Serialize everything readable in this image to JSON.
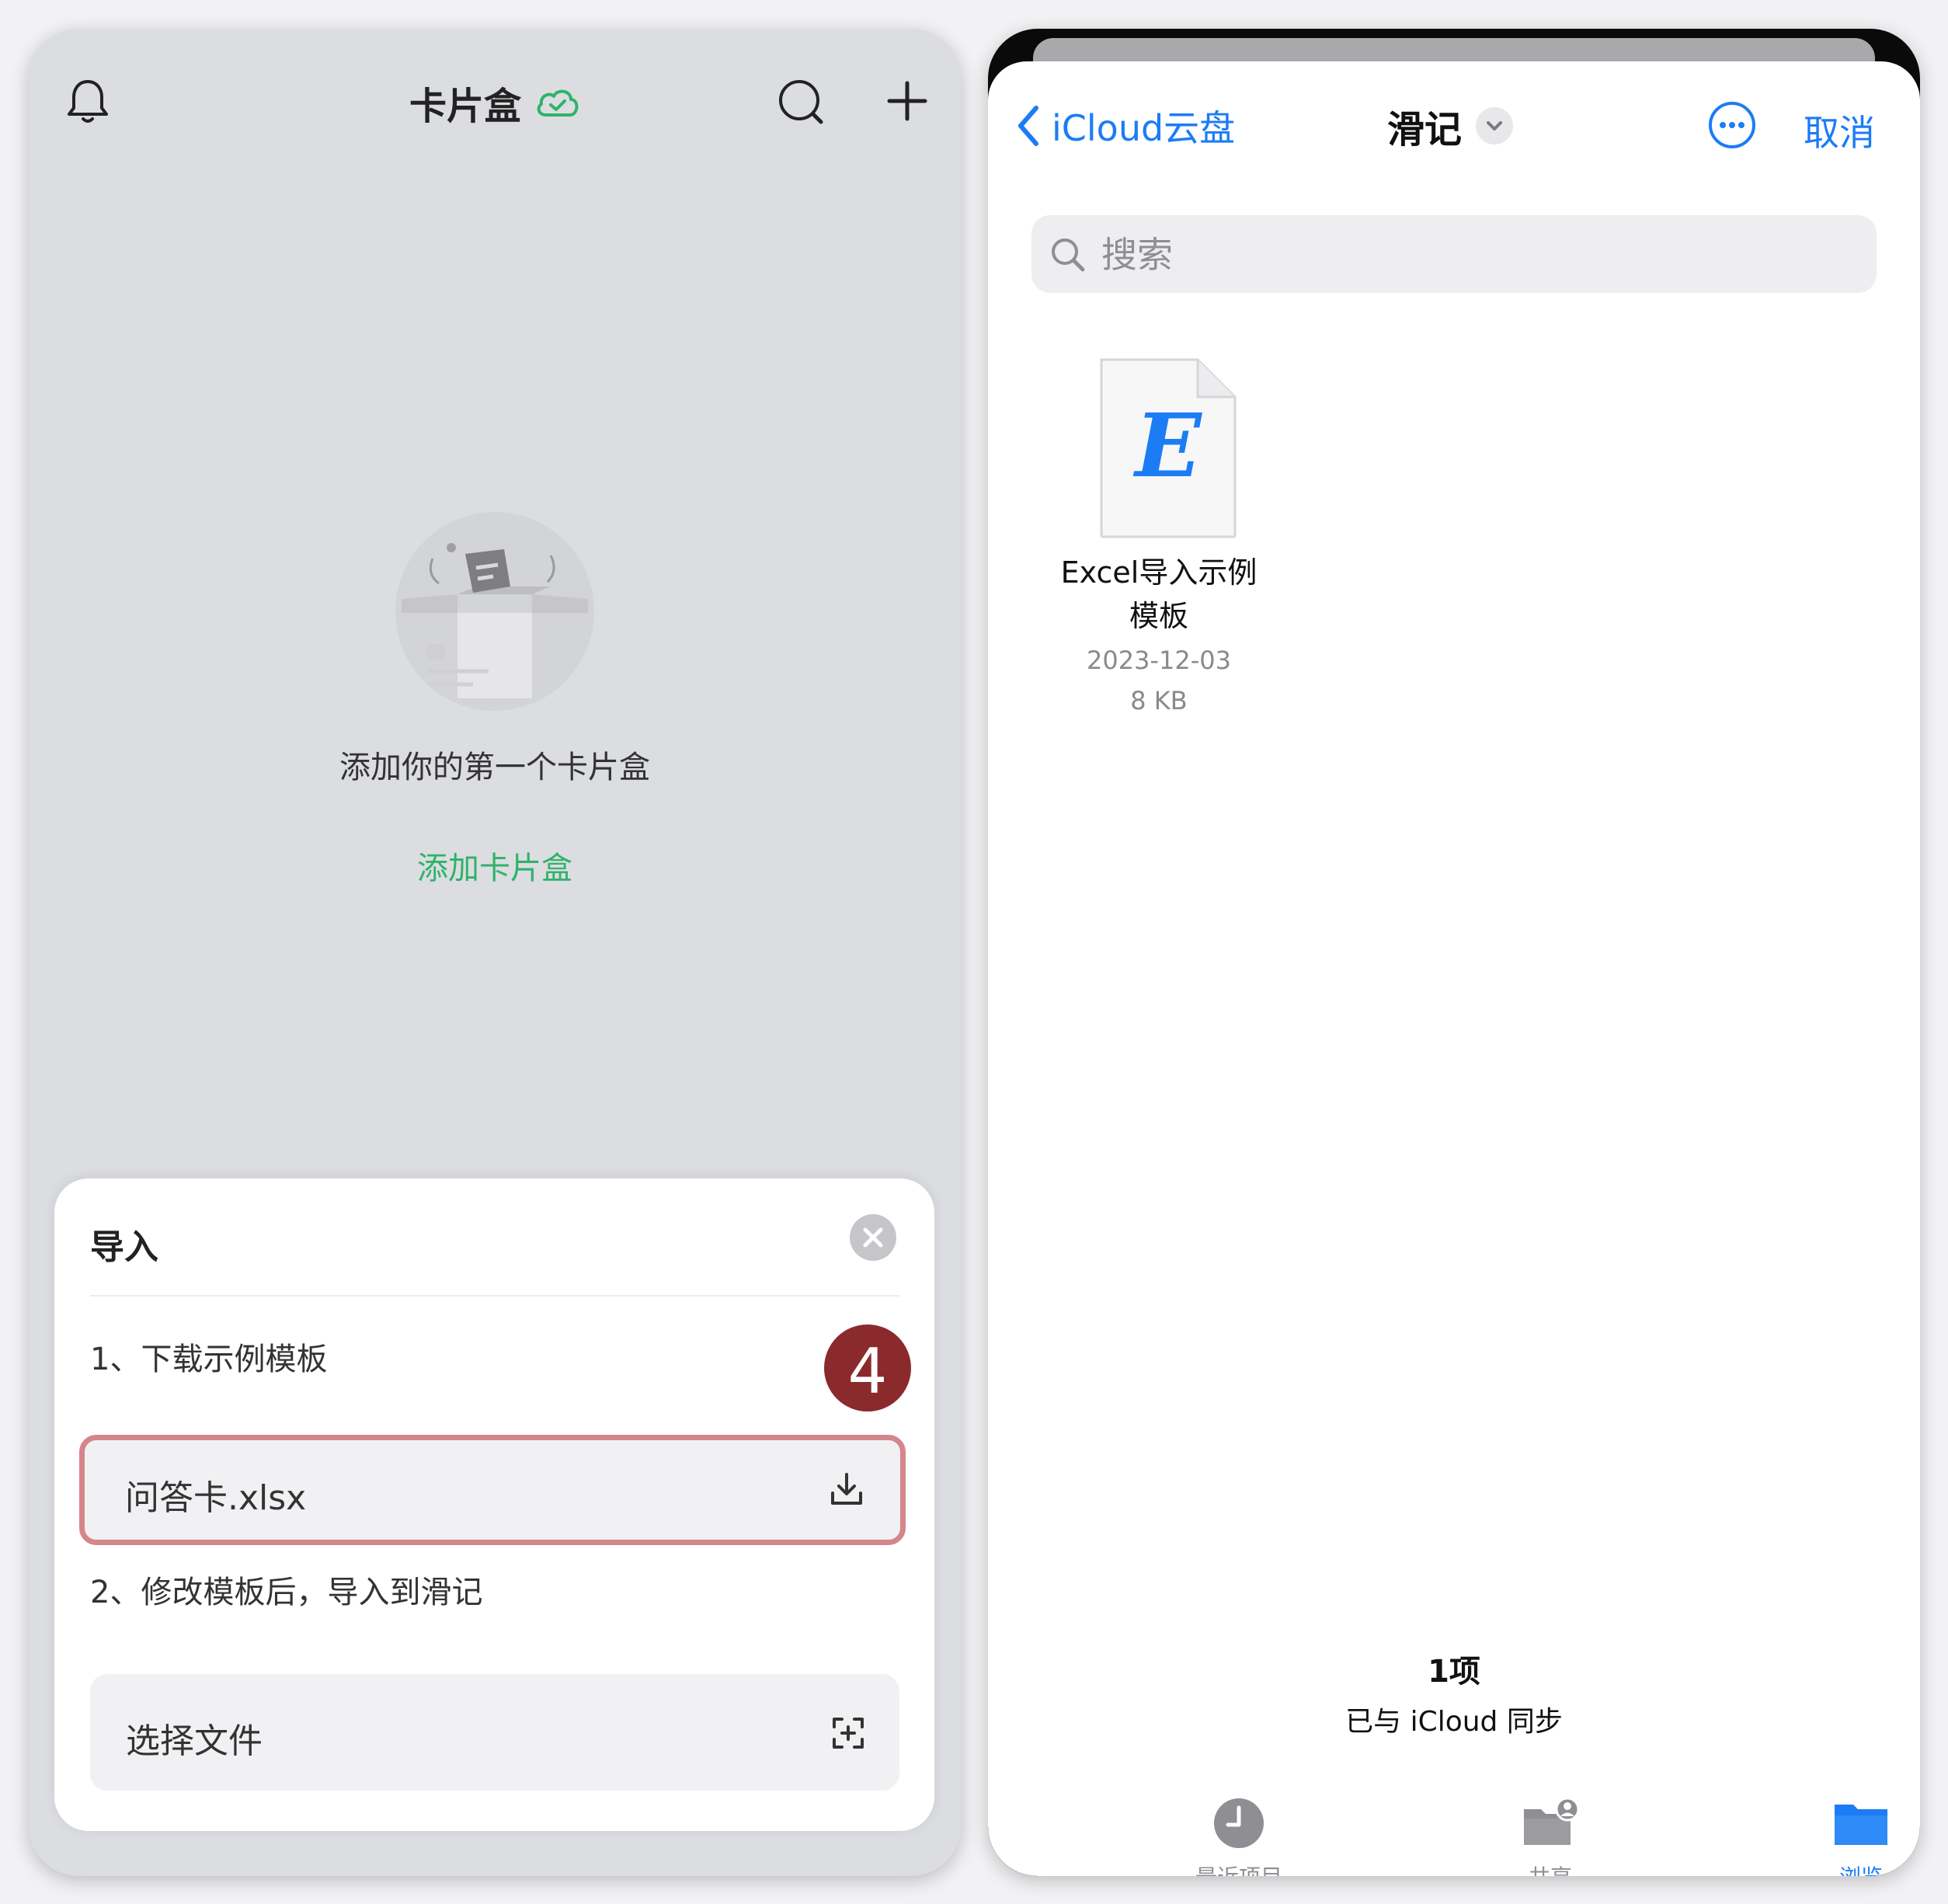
{
  "left_app": {
    "header": {
      "title": "卡片盒"
    },
    "empty_state": {
      "message": "添加你的第一个卡片盒",
      "add_link": "添加卡片盒"
    },
    "import_sheet": {
      "title": "导入",
      "step1_label": "1、下载示例模板",
      "template_file": "问答卡.xlsx",
      "step2_label": "2、修改模板后，导入到滑记",
      "choose_file_label": "选择文件"
    },
    "annotation_badge": "4"
  },
  "file_picker": {
    "back_label": "iCloud云盘",
    "folder_title": "滑记",
    "cancel_label": "取消",
    "search": {
      "placeholder": "搜索"
    },
    "files": [
      {
        "name_line1": "Excel导入示例",
        "name_line2": "模板",
        "date": "2023-12-03",
        "size": "8 KB",
        "icon_letter": "E"
      }
    ],
    "footer": {
      "count": "1项",
      "sync_status": "已与 iCloud 同步"
    },
    "tabs": [
      {
        "label": "最近项目",
        "icon": "clock-icon"
      },
      {
        "label": "共享",
        "icon": "shared-folder-icon"
      },
      {
        "label": "浏览",
        "icon": "folder-icon",
        "active": true
      }
    ]
  },
  "colors": {
    "accent_green": "#2fb36a",
    "ios_blue": "#1c7cf5",
    "highlight_border": "#d4868b",
    "badge": "#8b2a2c"
  }
}
